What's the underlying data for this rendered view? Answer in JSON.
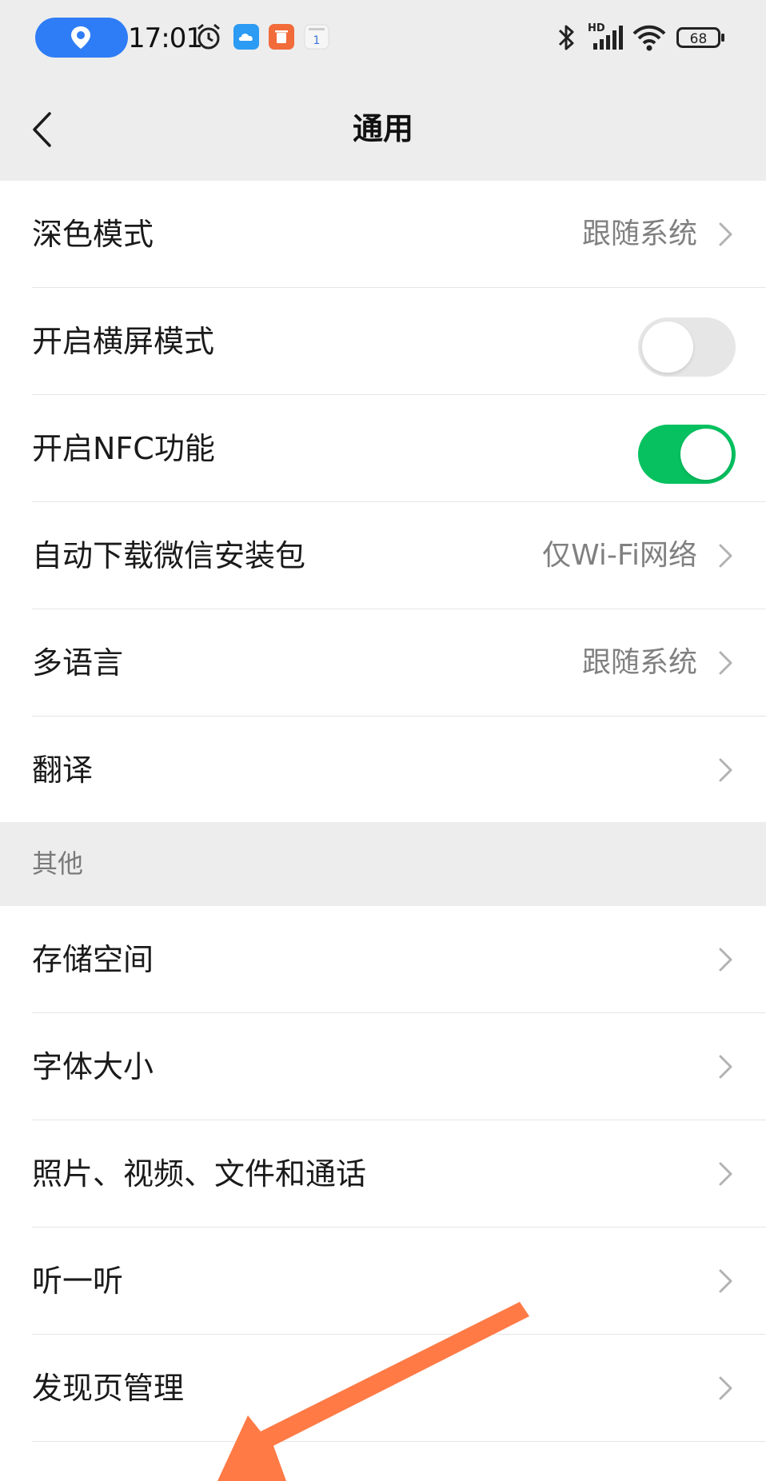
{
  "status_bar": {
    "time": "17:01",
    "battery": "68",
    "network": "HD",
    "icons": [
      "location-icon",
      "alarm-icon",
      "cloud-app-icon",
      "delete-app-icon",
      "calendar-icon",
      "bluetooth-icon",
      "signal-icon",
      "wifi-icon",
      "battery-icon"
    ]
  },
  "nav": {
    "title": "通用",
    "back_icon": "chevron-left-icon"
  },
  "group1": {
    "rows": [
      {
        "label": "深色模式",
        "value": "跟随系统"
      },
      {
        "label": "开启横屏模式",
        "toggle": false
      },
      {
        "label": "开启NFC功能",
        "toggle": true
      },
      {
        "label": "自动下载微信安装包",
        "value": "仅Wi-Fi网络"
      },
      {
        "label": "多语言",
        "value": "跟随系统"
      },
      {
        "label": "翻译"
      }
    ]
  },
  "section_other": {
    "header": "其他"
  },
  "group2": {
    "rows": [
      {
        "label": "存储空间"
      },
      {
        "label": "字体大小"
      },
      {
        "label": "照片、视频、文件和通话"
      },
      {
        "label": "听一听"
      },
      {
        "label": "发现页管理"
      }
    ]
  },
  "colors": {
    "background": "#ededed",
    "card": "#ffffff",
    "toggle_on": "#07c160",
    "toggle_off": "#e6e6e6",
    "annotation_arrow": "#ff7a45",
    "location_pill": "#2f7df6"
  }
}
